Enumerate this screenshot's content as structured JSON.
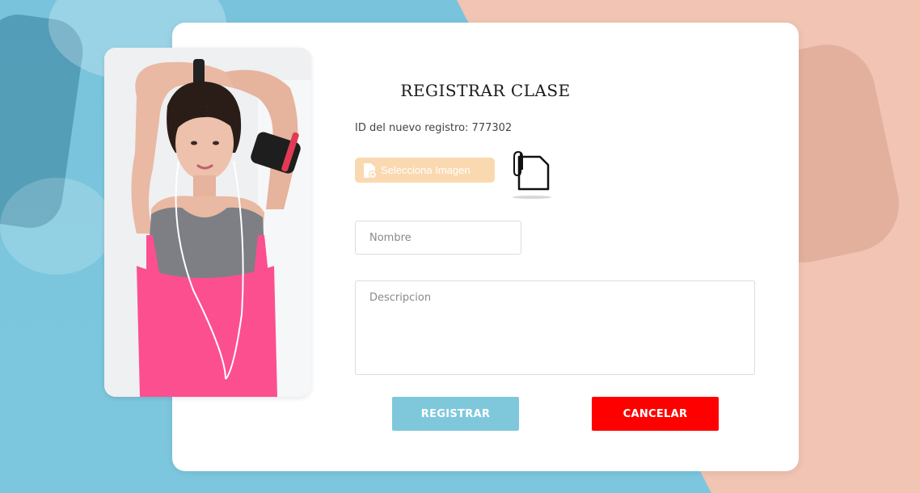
{
  "page": {
    "title": "REGISTRAR CLASE",
    "id_text": "ID del nuevo registro: 777302"
  },
  "form": {
    "select_image_label": "Selecciona Imagen",
    "name_placeholder": "Nombre",
    "name_value": "",
    "description_placeholder": "Descripcion",
    "description_value": ""
  },
  "actions": {
    "register_label": "REGISTRAR",
    "cancel_label": "CANCELAR"
  },
  "colors": {
    "register_bg": "#7fc8dc",
    "cancel_bg": "#ff0000",
    "select_image_bg": "#fad9b0",
    "background_left": "#79c4dc",
    "background_right": "#f1c4b3"
  },
  "icons": {
    "select_image": "document-add-icon",
    "attachment": "paperclip-file-icon"
  }
}
